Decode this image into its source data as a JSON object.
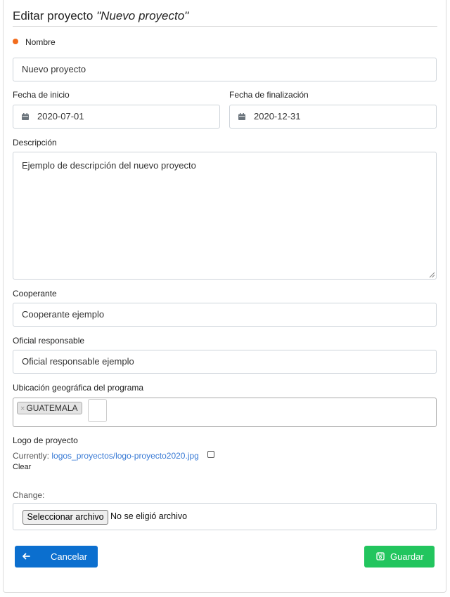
{
  "header": {
    "title_prefix": "Editar proyecto",
    "project_name": "\"Nuevo proyecto\""
  },
  "form": {
    "nombre": {
      "label": "Nombre",
      "value": "Nuevo proyecto",
      "required": true
    },
    "fecha_inicio": {
      "label": "Fecha de inicio",
      "value": "2020-07-01",
      "icon": "calendar-icon"
    },
    "fecha_fin": {
      "label": "Fecha de finalización",
      "value": "2020-12-31",
      "icon": "calendar-icon"
    },
    "descripcion": {
      "label": "Descripción",
      "value": "Ejemplo de descripción del nuevo proyecto"
    },
    "cooperante": {
      "label": "Cooperante",
      "value": "Cooperante ejemplo"
    },
    "oficial": {
      "label": "Oficial responsable",
      "value": "Oficial responsable ejemplo"
    },
    "ubicacion": {
      "label": "Ubicación geográfica del programa",
      "selected": [
        "GUATEMALA"
      ],
      "remove_glyph": "×"
    },
    "logo": {
      "label": "Logo de proyecto",
      "currently_label": "Currently:",
      "current_file": "logos_proyectos/logo-proyecto2020.jpg",
      "clear_label": "Clear",
      "change_label": "Change:",
      "file_button": "Seleccionar archivo",
      "file_status": "No se eligió archivo"
    }
  },
  "actions": {
    "cancel_label": "Cancelar",
    "save_label": "Guardar"
  },
  "colors": {
    "required_dot": "#f26c1c",
    "cancel_bg": "#0b6fcf",
    "save_bg": "#22c55e",
    "link": "#3a7bd5"
  }
}
